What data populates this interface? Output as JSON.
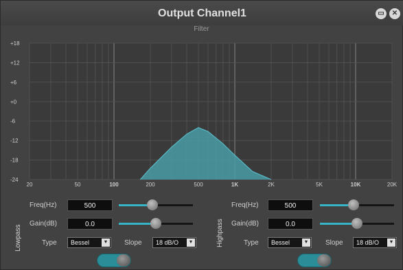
{
  "window": {
    "title": "Output Channel1",
    "subtitle": "Filter"
  },
  "controls": {
    "restore_icon": "restore-icon",
    "close_icon": "close-icon",
    "restore_glyph": "▭",
    "close_glyph": "✕"
  },
  "chart_data": {
    "type": "area",
    "y_ticks": [
      "+18",
      "+12",
      "+6",
      "+0",
      "-6",
      "-12",
      "-18",
      "-24"
    ],
    "x_ticks": [
      "20",
      "50",
      "100",
      "200",
      "500",
      "1K",
      "2K",
      "5K",
      "10K",
      "20K"
    ],
    "bold_x_ticks": [
      "100",
      "1K",
      "10K"
    ],
    "xlim": [
      20,
      20000
    ],
    "ylim": [
      -24,
      18
    ],
    "x_scale": "log",
    "series": [
      {
        "x": [
          165,
          200,
          300,
          400,
          500,
          600,
          800,
          1000,
          1400,
          2000
        ],
        "y": [
          -24,
          -20.5,
          -14,
          -10,
          -8,
          -9.2,
          -13,
          -16.5,
          -21.5,
          -24
        ]
      }
    ],
    "fill_color": "#4a9ca6",
    "line_color": "#58b8c4",
    "grid": true
  },
  "lowpass": {
    "section_label": "Lowpass",
    "freq_label": "Freq(Hz)",
    "freq_value": "500",
    "freq_slider": 0.45,
    "gain_label": "Gain(dB)",
    "gain_value": "0.0",
    "gain_slider": 0.5,
    "type_label": "Type",
    "type_value": "Bessel",
    "slope_label": "Slope",
    "slope_value": "18 dB/O",
    "enabled": true
  },
  "highpass": {
    "section_label": "Highpass",
    "freq_label": "Freq(Hz)",
    "freq_value": "500",
    "freq_slider": 0.45,
    "gain_label": "Gain(dB)",
    "gain_value": "0.0",
    "gain_slider": 0.5,
    "type_label": "Type",
    "type_value": "Bessel",
    "slope_label": "Slope",
    "slope_value": "18 dB/O",
    "enabled": true
  },
  "colors": {
    "accent": "#35b5c6",
    "toggle_on": "#2a8d97"
  }
}
